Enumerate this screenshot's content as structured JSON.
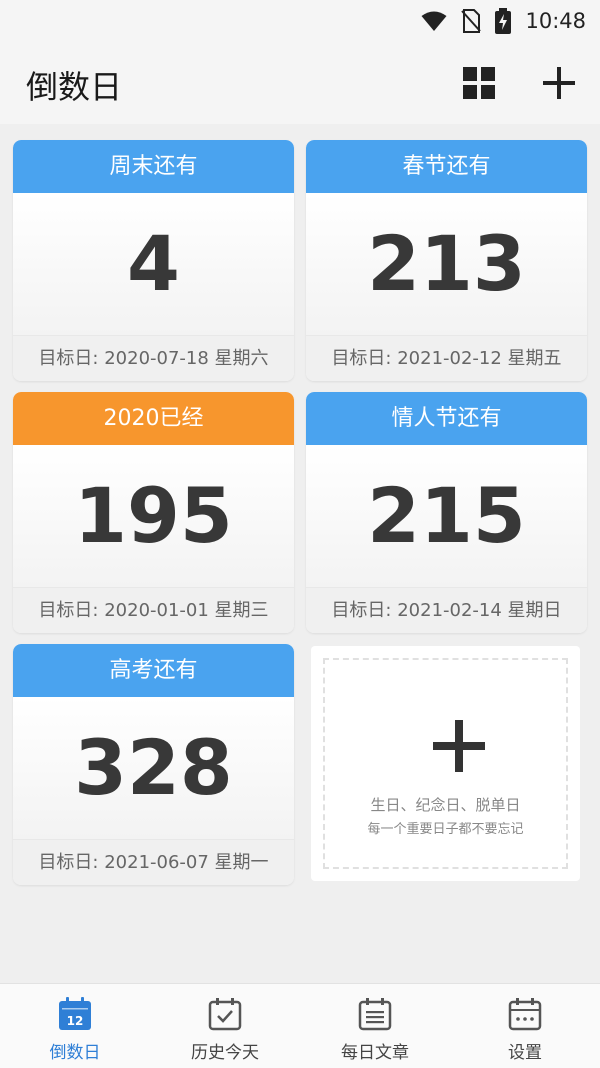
{
  "status_bar": {
    "time": "10:48"
  },
  "app_bar": {
    "title": "倒数日"
  },
  "cards": [
    {
      "title": "周末还有",
      "number": "4",
      "footer": "目标日: 2020-07-18 星期六",
      "header_color": "#4aa3ef"
    },
    {
      "title": "春节还有",
      "number": "213",
      "footer": "目标日: 2021-02-12 星期五",
      "header_color": "#4aa3ef"
    },
    {
      "title": "2020已经",
      "number": "195",
      "footer": "目标日: 2020-01-01 星期三",
      "header_color": "#f7962d"
    },
    {
      "title": "情人节还有",
      "number": "215",
      "footer": "目标日: 2021-02-14 星期日",
      "header_color": "#4aa3ef"
    },
    {
      "title": "高考还有",
      "number": "328",
      "footer": "目标日: 2021-06-07 星期一",
      "header_color": "#4aa3ef"
    }
  ],
  "add_card": {
    "line1": "生日、纪念日、脱单日",
    "line2": "每一个重要日子都不要忘记"
  },
  "bottom_nav": {
    "items": [
      {
        "label": "倒数日",
        "icon": "calendar-12-icon",
        "badge": "12"
      },
      {
        "label": "历史今天",
        "icon": "calendar-check-icon"
      },
      {
        "label": "每日文章",
        "icon": "article-icon"
      },
      {
        "label": "设置",
        "icon": "calendar-dots-icon"
      }
    ],
    "active_index": 0,
    "active_color": "#2f7fd6"
  }
}
